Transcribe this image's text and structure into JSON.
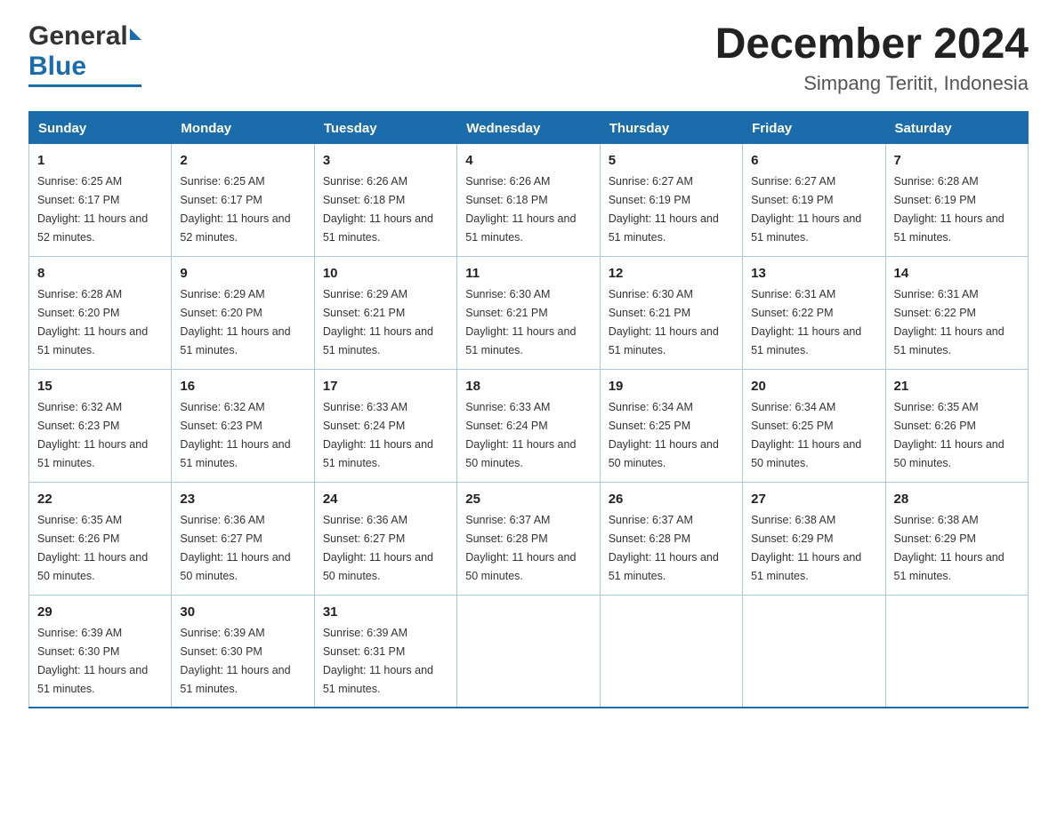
{
  "logo": {
    "general": "General",
    "blue": "Blue",
    "underline": true
  },
  "header": {
    "month": "December 2024",
    "location": "Simpang Teritit, Indonesia"
  },
  "days_of_week": [
    "Sunday",
    "Monday",
    "Tuesday",
    "Wednesday",
    "Thursday",
    "Friday",
    "Saturday"
  ],
  "weeks": [
    [
      {
        "day": "1",
        "sunrise": "6:25 AM",
        "sunset": "6:17 PM",
        "daylight": "11 hours and 52 minutes."
      },
      {
        "day": "2",
        "sunrise": "6:25 AM",
        "sunset": "6:17 PM",
        "daylight": "11 hours and 52 minutes."
      },
      {
        "day": "3",
        "sunrise": "6:26 AM",
        "sunset": "6:18 PM",
        "daylight": "11 hours and 51 minutes."
      },
      {
        "day": "4",
        "sunrise": "6:26 AM",
        "sunset": "6:18 PM",
        "daylight": "11 hours and 51 minutes."
      },
      {
        "day": "5",
        "sunrise": "6:27 AM",
        "sunset": "6:19 PM",
        "daylight": "11 hours and 51 minutes."
      },
      {
        "day": "6",
        "sunrise": "6:27 AM",
        "sunset": "6:19 PM",
        "daylight": "11 hours and 51 minutes."
      },
      {
        "day": "7",
        "sunrise": "6:28 AM",
        "sunset": "6:19 PM",
        "daylight": "11 hours and 51 minutes."
      }
    ],
    [
      {
        "day": "8",
        "sunrise": "6:28 AM",
        "sunset": "6:20 PM",
        "daylight": "11 hours and 51 minutes."
      },
      {
        "day": "9",
        "sunrise": "6:29 AM",
        "sunset": "6:20 PM",
        "daylight": "11 hours and 51 minutes."
      },
      {
        "day": "10",
        "sunrise": "6:29 AM",
        "sunset": "6:21 PM",
        "daylight": "11 hours and 51 minutes."
      },
      {
        "day": "11",
        "sunrise": "6:30 AM",
        "sunset": "6:21 PM",
        "daylight": "11 hours and 51 minutes."
      },
      {
        "day": "12",
        "sunrise": "6:30 AM",
        "sunset": "6:21 PM",
        "daylight": "11 hours and 51 minutes."
      },
      {
        "day": "13",
        "sunrise": "6:31 AM",
        "sunset": "6:22 PM",
        "daylight": "11 hours and 51 minutes."
      },
      {
        "day": "14",
        "sunrise": "6:31 AM",
        "sunset": "6:22 PM",
        "daylight": "11 hours and 51 minutes."
      }
    ],
    [
      {
        "day": "15",
        "sunrise": "6:32 AM",
        "sunset": "6:23 PM",
        "daylight": "11 hours and 51 minutes."
      },
      {
        "day": "16",
        "sunrise": "6:32 AM",
        "sunset": "6:23 PM",
        "daylight": "11 hours and 51 minutes."
      },
      {
        "day": "17",
        "sunrise": "6:33 AM",
        "sunset": "6:24 PM",
        "daylight": "11 hours and 51 minutes."
      },
      {
        "day": "18",
        "sunrise": "6:33 AM",
        "sunset": "6:24 PM",
        "daylight": "11 hours and 50 minutes."
      },
      {
        "day": "19",
        "sunrise": "6:34 AM",
        "sunset": "6:25 PM",
        "daylight": "11 hours and 50 minutes."
      },
      {
        "day": "20",
        "sunrise": "6:34 AM",
        "sunset": "6:25 PM",
        "daylight": "11 hours and 50 minutes."
      },
      {
        "day": "21",
        "sunrise": "6:35 AM",
        "sunset": "6:26 PM",
        "daylight": "11 hours and 50 minutes."
      }
    ],
    [
      {
        "day": "22",
        "sunrise": "6:35 AM",
        "sunset": "6:26 PM",
        "daylight": "11 hours and 50 minutes."
      },
      {
        "day": "23",
        "sunrise": "6:36 AM",
        "sunset": "6:27 PM",
        "daylight": "11 hours and 50 minutes."
      },
      {
        "day": "24",
        "sunrise": "6:36 AM",
        "sunset": "6:27 PM",
        "daylight": "11 hours and 50 minutes."
      },
      {
        "day": "25",
        "sunrise": "6:37 AM",
        "sunset": "6:28 PM",
        "daylight": "11 hours and 50 minutes."
      },
      {
        "day": "26",
        "sunrise": "6:37 AM",
        "sunset": "6:28 PM",
        "daylight": "11 hours and 51 minutes."
      },
      {
        "day": "27",
        "sunrise": "6:38 AM",
        "sunset": "6:29 PM",
        "daylight": "11 hours and 51 minutes."
      },
      {
        "day": "28",
        "sunrise": "6:38 AM",
        "sunset": "6:29 PM",
        "daylight": "11 hours and 51 minutes."
      }
    ],
    [
      {
        "day": "29",
        "sunrise": "6:39 AM",
        "sunset": "6:30 PM",
        "daylight": "11 hours and 51 minutes."
      },
      {
        "day": "30",
        "sunrise": "6:39 AM",
        "sunset": "6:30 PM",
        "daylight": "11 hours and 51 minutes."
      },
      {
        "day": "31",
        "sunrise": "6:39 AM",
        "sunset": "6:31 PM",
        "daylight": "11 hours and 51 minutes."
      },
      null,
      null,
      null,
      null
    ]
  ],
  "labels": {
    "sunrise": "Sunrise:",
    "sunset": "Sunset:",
    "daylight": "Daylight:"
  }
}
